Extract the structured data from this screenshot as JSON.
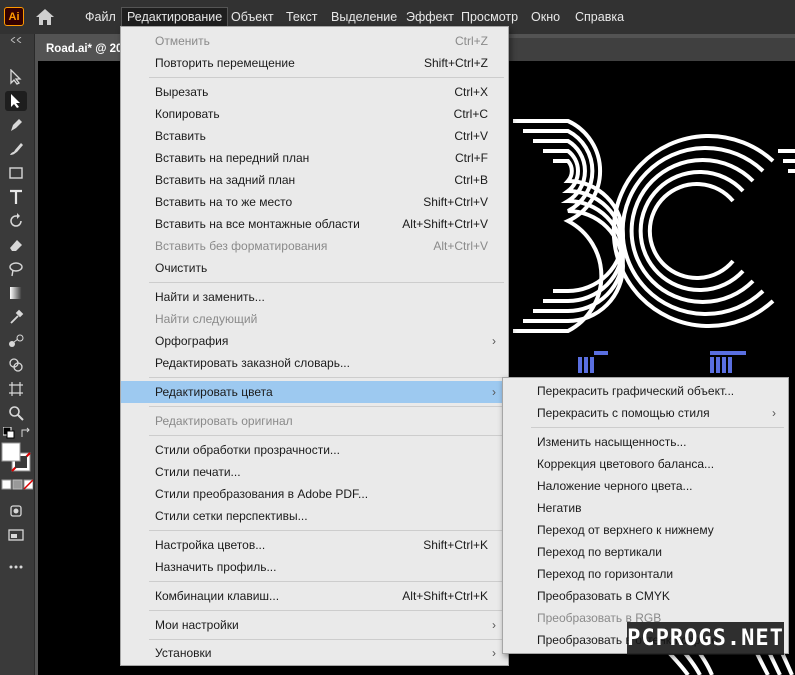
{
  "app": {
    "logo": "Ai"
  },
  "menubar": {
    "items": [
      {
        "label": "Файл"
      },
      {
        "label": "Редактирование"
      },
      {
        "label": "Объект"
      },
      {
        "label": "Текст"
      },
      {
        "label": "Выделение"
      },
      {
        "label": "Эффект"
      },
      {
        "label": "Просмотр"
      },
      {
        "label": "Окно"
      },
      {
        "label": "Справка"
      }
    ]
  },
  "document": {
    "tab_title": "Road.ai* @ 20"
  },
  "edit_menu": {
    "items": [
      {
        "label": "Отменить",
        "shortcut": "Ctrl+Z",
        "disabled": true
      },
      {
        "label": "Повторить перемещение",
        "shortcut": "Shift+Ctrl+Z"
      },
      {
        "label": "Вырезать",
        "shortcut": "Ctrl+X"
      },
      {
        "label": "Копировать",
        "shortcut": "Ctrl+C"
      },
      {
        "label": "Вставить",
        "shortcut": "Ctrl+V"
      },
      {
        "label": "Вставить на передний план",
        "shortcut": "Ctrl+F"
      },
      {
        "label": "Вставить на задний план",
        "shortcut": "Ctrl+B"
      },
      {
        "label": "Вставить на то же место",
        "shortcut": "Shift+Ctrl+V"
      },
      {
        "label": "Вставить на все монтажные области",
        "shortcut": "Alt+Shift+Ctrl+V"
      },
      {
        "label": "Вставить без форматирования",
        "shortcut": "Alt+Ctrl+V",
        "disabled": true
      },
      {
        "label": "Очистить"
      },
      {
        "label": "Найти и заменить..."
      },
      {
        "label": "Найти следующий",
        "disabled": true
      },
      {
        "label": "Орфография",
        "submenu": true
      },
      {
        "label": "Редактировать заказной словарь..."
      },
      {
        "label": "Редактировать цвета",
        "submenu": true,
        "highlighted": true
      },
      {
        "label": "Редактировать оригинал",
        "disabled": true
      },
      {
        "label": "Стили обработки прозрачности..."
      },
      {
        "label": "Стили печати..."
      },
      {
        "label": "Стили преобразования в Adobe PDF..."
      },
      {
        "label": "Стили сетки перспективы..."
      },
      {
        "label": "Настройка цветов...",
        "shortcut": "Shift+Ctrl+K"
      },
      {
        "label": "Назначить профиль..."
      },
      {
        "label": "Комбинации клавиш...",
        "shortcut": "Alt+Shift+Ctrl+K"
      },
      {
        "label": "Мои настройки",
        "submenu": true
      },
      {
        "label": "Установки",
        "submenu": true
      }
    ],
    "arrow": "›"
  },
  "colors_submenu": {
    "items": [
      {
        "label": "Перекрасить графический объект..."
      },
      {
        "label": "Перекрасить с помощью стиля",
        "submenu": true
      },
      {
        "label": "Изменить насыщенность..."
      },
      {
        "label": "Коррекция цветового баланса..."
      },
      {
        "label": "Наложение черного цвета..."
      },
      {
        "label": "Негатив"
      },
      {
        "label": "Переход от верхнего к нижнему"
      },
      {
        "label": "Переход по вертикали"
      },
      {
        "label": "Переход по горизонтали"
      },
      {
        "label": "Преобразовать в CMYK"
      },
      {
        "label": "Преобразовать в RGB",
        "disabled": true
      },
      {
        "label": "Преобразовать в оттенки серого"
      }
    ]
  },
  "watermark": {
    "text": "PCPROGS.NET"
  },
  "colors": {
    "highlight": "#9dc9f0",
    "menu_bg": "#eaeaea",
    "canvas": "#000000",
    "accent": "#ff9a00"
  }
}
